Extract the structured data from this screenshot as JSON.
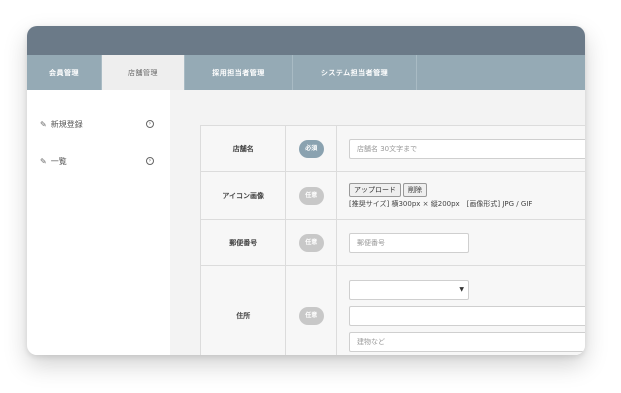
{
  "tabs": [
    {
      "label": "会員管理",
      "active": false
    },
    {
      "label": "店舗管理",
      "active": true
    },
    {
      "label": "採用担当者管理",
      "active": false
    },
    {
      "label": "システム担当者管理",
      "active": false
    }
  ],
  "sidebar": {
    "items": [
      {
        "label": "新規登録",
        "icon": "edit-icon",
        "chevron": "circle-arrow-icon"
      },
      {
        "label": "一覧",
        "icon": "edit-icon",
        "chevron": "circle-arrow-icon"
      }
    ]
  },
  "form": {
    "store_name": {
      "label": "店舗名",
      "badge": "必須",
      "placeholder": "店舗名 30文字まで"
    },
    "icon_image": {
      "label": "アイコン画像",
      "badge": "任意",
      "upload_label": "アップロード",
      "delete_label": "削除",
      "hint": "[推奨サイズ] 横300px × 縦200px　[画像形式] JPG / GIF"
    },
    "postal_code": {
      "label": "郵便番号",
      "badge": "任意",
      "placeholder": "郵便番号"
    },
    "address": {
      "label": "住所",
      "badge": "任意",
      "select_value": "",
      "address_value": "",
      "building_placeholder": "建物など"
    }
  },
  "colors": {
    "titlebar": "#6b7a88",
    "tabbar": "#95aab5",
    "required_badge": "#8aa2b0",
    "optional_badge": "#c8c8c8"
  }
}
